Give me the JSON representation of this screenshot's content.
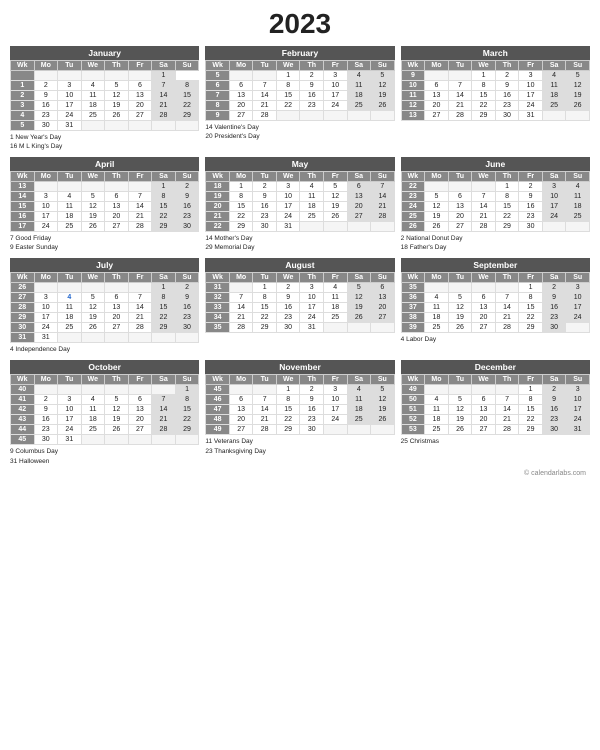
{
  "title": "2023",
  "footer": "© calendarlabs.com",
  "months": [
    {
      "name": "January",
      "headers": [
        "Wk",
        "Mo",
        "Tu",
        "We",
        "Th",
        "Fr",
        "Sa",
        "Su"
      ],
      "rows": [
        [
          "",
          "",
          "",
          "",
          "",
          "",
          "1"
        ],
        [
          "1",
          "2",
          "3",
          "4",
          "5",
          "6",
          "7",
          "8"
        ],
        [
          "2",
          "9",
          "10",
          "11",
          "12",
          "13",
          "14",
          "15"
        ],
        [
          "3",
          "16",
          "17",
          "18",
          "19",
          "20",
          "21",
          "22"
        ],
        [
          "4",
          "23",
          "24",
          "25",
          "26",
          "27",
          "28",
          "29"
        ],
        [
          "5",
          "30",
          "31",
          "",
          "",
          "",
          "",
          ""
        ]
      ],
      "sat_col": 6,
      "sun_col": 7,
      "highlights": [],
      "holidays": [
        "1  New Year's Day",
        "16  M L King's Day"
      ]
    },
    {
      "name": "February",
      "headers": [
        "Wk",
        "Mo",
        "Tu",
        "We",
        "Th",
        "Fr",
        "Sa",
        "Su"
      ],
      "rows": [
        [
          "5",
          "",
          "",
          "1",
          "2",
          "3",
          "4",
          "5"
        ],
        [
          "6",
          "6",
          "7",
          "8",
          "9",
          "10",
          "11",
          "12"
        ],
        [
          "7",
          "13",
          "14",
          "15",
          "16",
          "17",
          "18",
          "19"
        ],
        [
          "8",
          "20",
          "21",
          "22",
          "23",
          "24",
          "25",
          "26"
        ],
        [
          "9",
          "27",
          "28",
          "",
          "",
          "",
          "",
          ""
        ]
      ],
      "highlights": [],
      "holidays": [
        "14  Valentine's Day",
        "20  President's Day"
      ]
    },
    {
      "name": "March",
      "headers": [
        "Wk",
        "Mo",
        "Tu",
        "We",
        "Th",
        "Fr",
        "Sa",
        "Su"
      ],
      "rows": [
        [
          "9",
          "",
          "",
          "1",
          "2",
          "3",
          "4",
          "5"
        ],
        [
          "10",
          "6",
          "7",
          "8",
          "9",
          "10",
          "11",
          "12"
        ],
        [
          "11",
          "13",
          "14",
          "15",
          "16",
          "17",
          "18",
          "19"
        ],
        [
          "12",
          "20",
          "21",
          "22",
          "23",
          "24",
          "25",
          "26"
        ],
        [
          "13",
          "27",
          "28",
          "29",
          "30",
          "31",
          "",
          ""
        ]
      ],
      "highlights": [],
      "holidays": []
    },
    {
      "name": "April",
      "headers": [
        "Wk",
        "Mo",
        "Tu",
        "We",
        "Th",
        "Fr",
        "Sa",
        "Su"
      ],
      "rows": [
        [
          "13",
          "",
          "",
          "",
          "",
          "",
          "1",
          "2"
        ],
        [
          "14",
          "3",
          "4",
          "5",
          "6",
          "7",
          "8",
          "9"
        ],
        [
          "15",
          "10",
          "11",
          "12",
          "13",
          "14",
          "15",
          "16"
        ],
        [
          "16",
          "17",
          "18",
          "19",
          "20",
          "21",
          "22",
          "23"
        ],
        [
          "17",
          "24",
          "25",
          "26",
          "27",
          "28",
          "29",
          "30"
        ]
      ],
      "holidays": [
        "7  Good Friday",
        "9  Easter Sunday"
      ]
    },
    {
      "name": "May",
      "headers": [
        "Wk",
        "Mo",
        "Tu",
        "We",
        "Th",
        "Fr",
        "Sa",
        "Su"
      ],
      "rows": [
        [
          "18",
          "1",
          "2",
          "3",
          "4",
          "5",
          "6",
          "7"
        ],
        [
          "19",
          "8",
          "9",
          "10",
          "11",
          "12",
          "13",
          "14"
        ],
        [
          "20",
          "15",
          "16",
          "17",
          "18",
          "19",
          "20",
          "21"
        ],
        [
          "21",
          "22",
          "23",
          "24",
          "25",
          "26",
          "27",
          "28"
        ],
        [
          "22",
          "29",
          "30",
          "31",
          "",
          "",
          "",
          ""
        ]
      ],
      "holidays": [
        "14  Mother's Day",
        "29  Memorial Day"
      ]
    },
    {
      "name": "June",
      "headers": [
        "Wk",
        "Mo",
        "Tu",
        "We",
        "Th",
        "Fr",
        "Sa",
        "Su"
      ],
      "rows": [
        [
          "22",
          "",
          "",
          "",
          "1",
          "2",
          "3",
          "4"
        ],
        [
          "23",
          "5",
          "6",
          "7",
          "8",
          "9",
          "10",
          "11"
        ],
        [
          "24",
          "12",
          "13",
          "14",
          "15",
          "16",
          "17",
          "18"
        ],
        [
          "25",
          "19",
          "20",
          "21",
          "22",
          "23",
          "24",
          "25"
        ],
        [
          "26",
          "26",
          "27",
          "28",
          "29",
          "30",
          "",
          ""
        ]
      ],
      "holidays": [
        "2  National Donut Day",
        "18  Father's Day"
      ]
    },
    {
      "name": "July",
      "headers": [
        "Wk",
        "Mo",
        "Tu",
        "We",
        "Th",
        "Fr",
        "Sa",
        "Su"
      ],
      "rows": [
        [
          "26",
          "",
          "",
          "",
          "",
          "",
          "1",
          "2"
        ],
        [
          "27",
          "3",
          "4",
          "5",
          "6",
          "7",
          "8",
          "9"
        ],
        [
          "28",
          "10",
          "11",
          "12",
          "13",
          "14",
          "15",
          "16"
        ],
        [
          "29",
          "17",
          "18",
          "19",
          "20",
          "21",
          "22",
          "23"
        ],
        [
          "30",
          "24",
          "25",
          "26",
          "27",
          "28",
          "29",
          "30"
        ],
        [
          "31",
          "31",
          "",
          "",
          "",
          "",
          "",
          ""
        ]
      ],
      "highlights": [
        "4"
      ],
      "holidays": [
        "4  Independence Day"
      ]
    },
    {
      "name": "August",
      "headers": [
        "Wk",
        "Mo",
        "Tu",
        "We",
        "Th",
        "Fr",
        "Sa",
        "Su"
      ],
      "rows": [
        [
          "31",
          "",
          "1",
          "2",
          "3",
          "4",
          "5",
          "6"
        ],
        [
          "32",
          "7",
          "8",
          "9",
          "10",
          "11",
          "12",
          "13"
        ],
        [
          "33",
          "14",
          "15",
          "16",
          "17",
          "18",
          "19",
          "20"
        ],
        [
          "34",
          "21",
          "22",
          "23",
          "24",
          "25",
          "26",
          "27"
        ],
        [
          "35",
          "28",
          "29",
          "30",
          "31",
          "",
          "",
          ""
        ]
      ],
      "holidays": []
    },
    {
      "name": "September",
      "headers": [
        "Wk",
        "Mo",
        "Tu",
        "We",
        "Th",
        "Fr",
        "Sa",
        "Su"
      ],
      "rows": [
        [
          "35",
          "",
          "",
          "",
          "",
          "1",
          "2",
          "3"
        ],
        [
          "36",
          "4",
          "5",
          "6",
          "7",
          "8",
          "9",
          "10"
        ],
        [
          "37",
          "11",
          "12",
          "13",
          "14",
          "15",
          "16",
          "17"
        ],
        [
          "38",
          "18",
          "19",
          "20",
          "21",
          "22",
          "23",
          "24"
        ],
        [
          "39",
          "25",
          "26",
          "27",
          "28",
          "29",
          "30",
          ""
        ]
      ],
      "holidays": [
        "4  Labor Day"
      ]
    },
    {
      "name": "October",
      "headers": [
        "Wk",
        "Mo",
        "Tu",
        "We",
        "Th",
        "Fr",
        "Sa",
        "Su"
      ],
      "rows": [
        [
          "40",
          "",
          "",
          "",
          "",
          "",
          "",
          "1"
        ],
        [
          "41",
          "2",
          "3",
          "4",
          "5",
          "6",
          "7",
          "8"
        ],
        [
          "42",
          "9",
          "10",
          "11",
          "12",
          "13",
          "14",
          "15"
        ],
        [
          "43",
          "16",
          "17",
          "18",
          "19",
          "20",
          "21",
          "22"
        ],
        [
          "44",
          "23",
          "24",
          "25",
          "26",
          "27",
          "28",
          "29"
        ],
        [
          "45",
          "30",
          "31",
          "",
          "",
          "",
          "",
          ""
        ]
      ],
      "holidays": [
        "9  Columbus Day",
        "31  Halloween"
      ]
    },
    {
      "name": "November",
      "headers": [
        "Wk",
        "Mo",
        "Tu",
        "We",
        "Th",
        "Fr",
        "Sa",
        "Su"
      ],
      "rows": [
        [
          "45",
          "",
          "",
          "1",
          "2",
          "3",
          "4",
          "5"
        ],
        [
          "46",
          "6",
          "7",
          "8",
          "9",
          "10",
          "11",
          "12"
        ],
        [
          "47",
          "13",
          "14",
          "15",
          "16",
          "17",
          "18",
          "19"
        ],
        [
          "48",
          "20",
          "21",
          "22",
          "23",
          "24",
          "25",
          "26"
        ],
        [
          "49",
          "27",
          "28",
          "29",
          "30",
          "",
          "",
          ""
        ]
      ],
      "holidays": [
        "11  Veterans Day",
        "23  Thanksgiving Day"
      ]
    },
    {
      "name": "December",
      "headers": [
        "Wk",
        "Mo",
        "Tu",
        "We",
        "Th",
        "Fr",
        "Sa",
        "Su"
      ],
      "rows": [
        [
          "49",
          "",
          "",
          "",
          "",
          "1",
          "2",
          "3"
        ],
        [
          "50",
          "4",
          "5",
          "6",
          "7",
          "8",
          "9",
          "10"
        ],
        [
          "51",
          "11",
          "12",
          "13",
          "14",
          "15",
          "16",
          "17"
        ],
        [
          "52",
          "18",
          "19",
          "20",
          "21",
          "22",
          "23",
          "24"
        ],
        [
          "53",
          "25",
          "26",
          "27",
          "28",
          "29",
          "30",
          "31"
        ]
      ],
      "holidays": [
        "25  Christmas"
      ]
    }
  ]
}
